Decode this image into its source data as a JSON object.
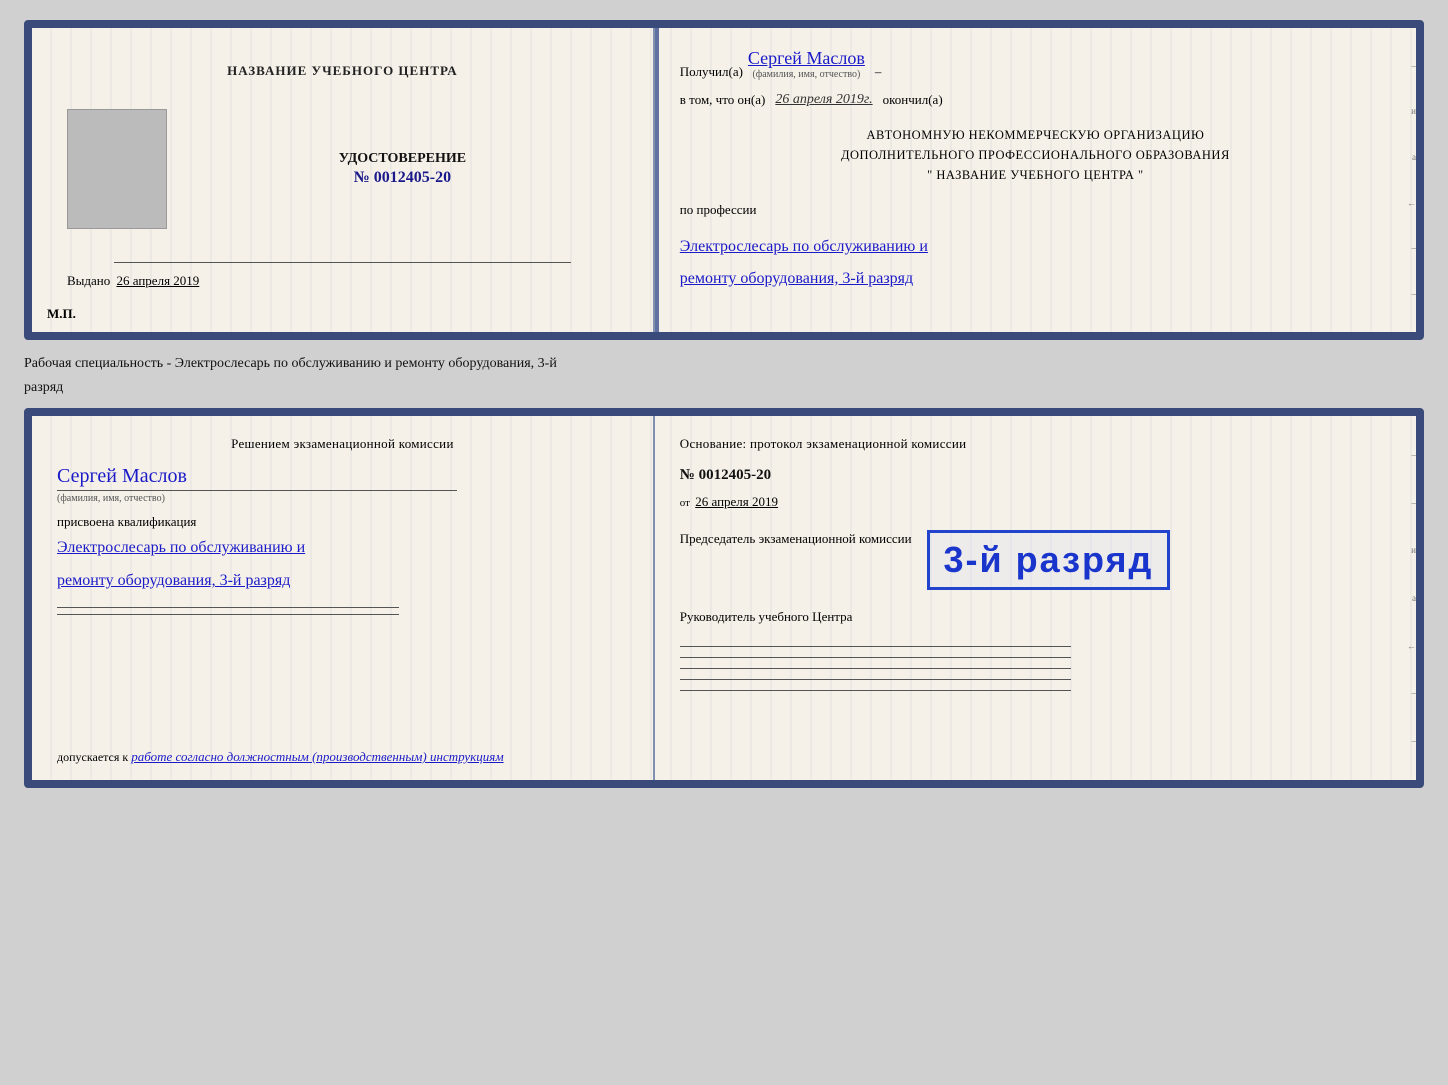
{
  "card1": {
    "left": {
      "center_name": "НАЗВАНИЕ УЧЕБНОГО ЦЕНТРА",
      "photo_alt": "photo",
      "udostoverenie": "УДОСТОВЕРЕНИЕ",
      "number": "№ 0012405-20",
      "vydano_label": "Выдано",
      "vydano_date": "26 апреля 2019",
      "mp": "М.П."
    },
    "right": {
      "poluchil": "Получил(а)",
      "name_handwritten": "Сергей Маслов",
      "fio_subtitle": "(фамилия, имя, отчество)",
      "dash": "–",
      "vtom_label": "в том, что он(а)",
      "vtom_date": "26 апреля 2019г.",
      "okoncnil": "окончил(а)",
      "avt_line1": "АВТОНОМНУЮ НЕКОММЕРЧЕСКУЮ ОРГАНИЗАЦИЮ",
      "avt_line2": "ДОПОЛНИТЕЛЬНОГО ПРОФЕССИОНАЛЬНОГО ОБРАЗОВАНИЯ",
      "avt_line3": "\"   НАЗВАНИЕ УЧЕБНОГО ЦЕНТРА   \"",
      "po_professii": "по профессии",
      "profession_line1": "Электрослесарь по обслуживанию и",
      "profession_line2": "ремонту оборудования, 3-й разряд",
      "side_chars": [
        "и",
        "а",
        "←",
        "–",
        "–"
      ]
    }
  },
  "between": {
    "text": "Рабочая специальность - Электрослесарь по обслуживанию и ремонту оборудования, 3-й",
    "text2": "разряд"
  },
  "card2": {
    "left": {
      "resheniem": "Решением экзаменационной  комиссии",
      "name_handwritten": "Сергей Маслов",
      "fio_subtitle": "(фамилия, имя, отчество)",
      "prisvoena": "присвоена квалификация",
      "qualification_line1": "Электрослесарь по обслуживанию и",
      "qualification_line2": "ремонту оборудования, 3-й разряд",
      "dopuskaetsya_label": "допускается к",
      "dopuskaetsya_text": "работе согласно должностным (производственным) инструкциям"
    },
    "right": {
      "osnovanie": "Основание: протокол экзаменационной  комиссии",
      "number": "№  0012405-20",
      "ot_label": "от",
      "ot_date": "26 апреля 2019",
      "predsedatel": "Председатель экзаменационной комиссии",
      "stamp_text": "3-й разряд",
      "rukovoditel": "Руководитель учебного Центра",
      "side_chars": [
        "и",
        "а",
        "←",
        "–",
        "–"
      ]
    }
  }
}
